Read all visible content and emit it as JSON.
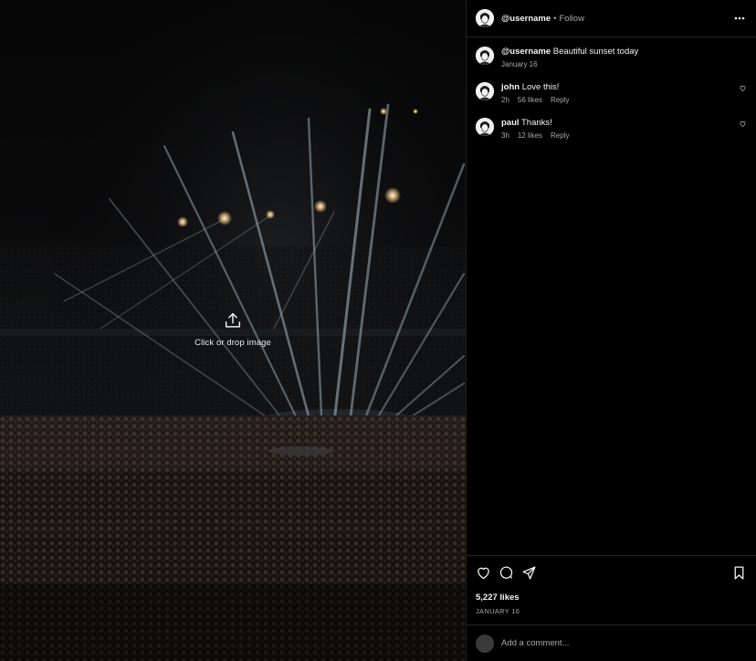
{
  "media": {
    "upload_label": "Click or drop image",
    "upload_icon": "upload-icon"
  },
  "post": {
    "username": "@username",
    "separator": "•",
    "follow_label": "Follow",
    "more_icon": "more-horizontal-icon"
  },
  "caption": {
    "username": "@username",
    "text": "Beautiful sunset today",
    "date": "January 16"
  },
  "comments": [
    {
      "username": "john",
      "text": "Love this!",
      "time": "2h",
      "likes": "56 likes",
      "reply_label": "Reply",
      "like_icon": "heart-outline-icon"
    },
    {
      "username": "paul",
      "text": "Thanks!",
      "time": "3h",
      "likes": "12 likes",
      "reply_label": "Reply",
      "like_icon": "heart-outline-icon"
    }
  ],
  "actions": {
    "like_icon": "heart-icon",
    "comment_icon": "comment-icon",
    "share_icon": "send-icon",
    "save_icon": "bookmark-icon",
    "likes_count": "5,227 likes",
    "date": "JANUARY 16"
  },
  "add_comment": {
    "placeholder": "Add a comment..."
  },
  "colors": {
    "background": "#000000",
    "text_primary": "#f5f5f5",
    "text_secondary": "#a8a8a8",
    "divider": "#262626"
  }
}
